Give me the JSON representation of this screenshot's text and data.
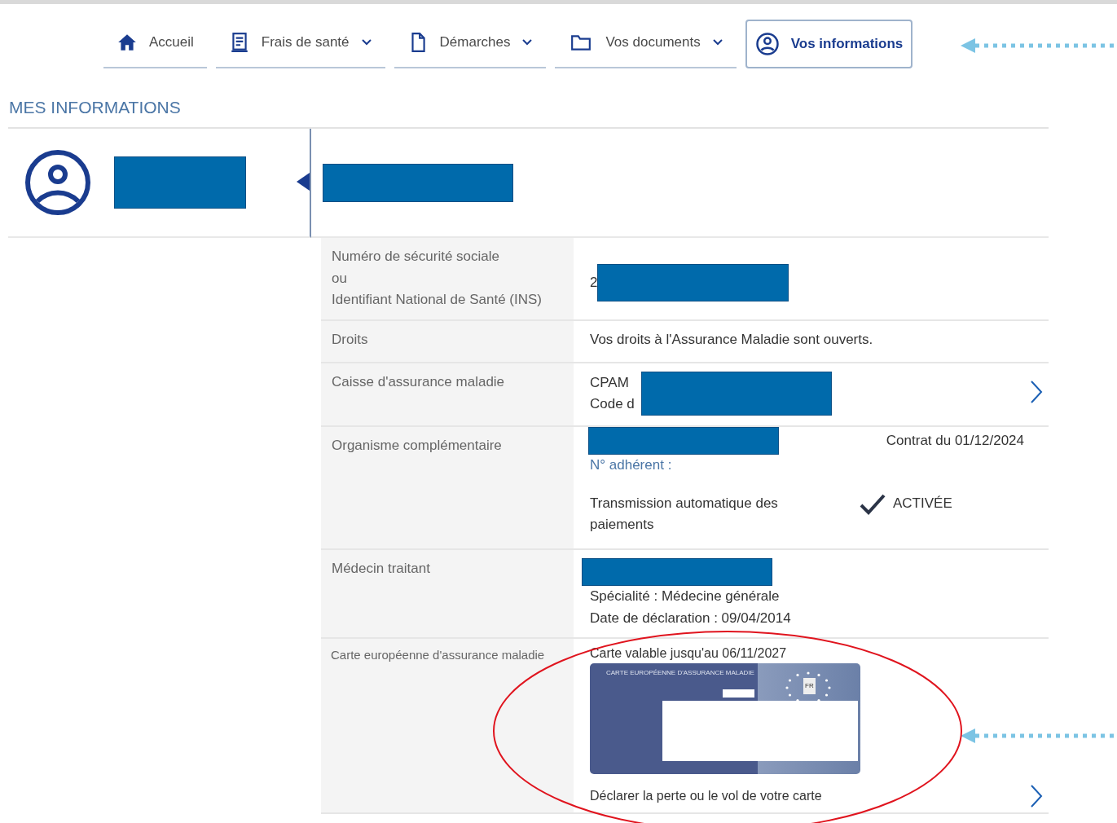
{
  "nav": [
    {
      "label": "Accueil",
      "dropdown": false,
      "selected": false
    },
    {
      "label": "Frais de santé",
      "dropdown": true,
      "selected": false
    },
    {
      "label": "Démarches",
      "dropdown": true,
      "selected": false
    },
    {
      "label": "Vos documents",
      "dropdown": true,
      "selected": false
    },
    {
      "label": "Vos informations",
      "dropdown": false,
      "selected": true
    }
  ],
  "page_title": "MES INFORMATIONS",
  "rows": [
    {
      "kind": "ssn",
      "label_lines": [
        "Numéro de sécurité sociale",
        "ou",
        "Identifiant National de Santé (INS)"
      ],
      "value": "2"
    },
    {
      "kind": "text",
      "label_lines": [
        "Droits"
      ],
      "value": "Vos droits à l'Assurance Maladie sont ouverts."
    },
    {
      "kind": "caisse",
      "label_lines": [
        "Caisse d'assurance maladie"
      ],
      "lines": [
        "CPAM",
        "Code d"
      ]
    },
    {
      "kind": "complementaire",
      "label_lines": [
        "Organisme complémentaire"
      ],
      "contract": "Contrat du 01/12/2024",
      "member": "N° adhérent :",
      "transmission": "Transmission automatique des paiements",
      "status": "ACTIVÉE",
      "activated": true
    },
    {
      "kind": "medecin",
      "label_lines": [
        "Médecin traitant"
      ],
      "lines": [
        "Spécialité : Médecine générale",
        "Date de déclaration :  09/04/2014"
      ]
    },
    {
      "kind": "carte",
      "label_lines": [
        "Carte européenne d'assurance maladie"
      ],
      "validity": "Carte valable jusqu'au 06/11/2027",
      "card_title": "CARTE EUROPÉENNE D'ASSURANCE MALADIE",
      "card_country": "FR",
      "link": "Déclarer la perte ou le vol de votre carte"
    }
  ]
}
